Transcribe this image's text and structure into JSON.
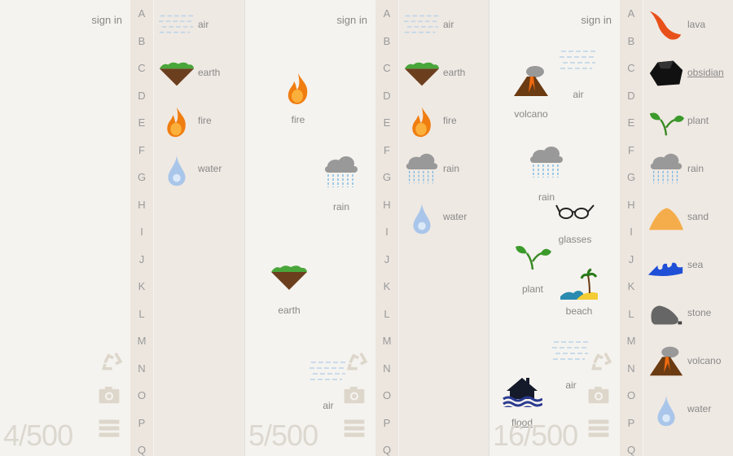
{
  "panels": [
    {
      "sign_in": "sign in",
      "counter": "4/500",
      "workspace": [],
      "list": [
        {
          "label": "air",
          "icon": "air-icon"
        },
        {
          "label": "earth",
          "icon": "earth-icon"
        },
        {
          "label": "fire",
          "icon": "fire-icon"
        },
        {
          "label": "water",
          "icon": "water-icon"
        }
      ]
    },
    {
      "sign_in": "sign in",
      "counter": "5/500",
      "workspace": [
        {
          "label": "fire",
          "icon": "fire-icon"
        },
        {
          "label": "rain",
          "icon": "rain-icon"
        },
        {
          "label": "earth",
          "icon": "earth-icon"
        },
        {
          "label": "air",
          "icon": "air-icon"
        }
      ],
      "list": [
        {
          "label": "air",
          "icon": "air-icon"
        },
        {
          "label": "earth",
          "icon": "earth-icon"
        },
        {
          "label": "fire",
          "icon": "fire-icon"
        },
        {
          "label": "rain",
          "icon": "rain-icon"
        },
        {
          "label": "water",
          "icon": "water-icon"
        }
      ]
    },
    {
      "sign_in": "sign in",
      "counter": "16/500",
      "workspace": [
        {
          "label": "volcano",
          "icon": "volcano-icon"
        },
        {
          "label": "air",
          "icon": "air-icon"
        },
        {
          "label": "rain",
          "icon": "rain-icon"
        },
        {
          "label": "glasses",
          "icon": "glasses-icon"
        },
        {
          "label": "plant",
          "icon": "plant-icon"
        },
        {
          "label": "beach",
          "icon": "beach-icon"
        },
        {
          "label": "air",
          "icon": "air-icon"
        },
        {
          "label": "flood",
          "icon": "flood-icon",
          "underlined": true
        }
      ],
      "list": [
        {
          "label": "lava",
          "icon": "lava-icon"
        },
        {
          "label": "obsidian",
          "icon": "obsidian-icon",
          "underlined": true
        },
        {
          "label": "plant",
          "icon": "plant-icon"
        },
        {
          "label": "rain",
          "icon": "rain-icon"
        },
        {
          "label": "sand",
          "icon": "sand-icon"
        },
        {
          "label": "sea",
          "icon": "sea-icon"
        },
        {
          "label": "stone",
          "icon": "stone-icon"
        },
        {
          "label": "volcano",
          "icon": "volcano-icon"
        },
        {
          "label": "water",
          "icon": "water-icon"
        }
      ]
    }
  ],
  "letters": [
    "A",
    "B",
    "C",
    "D",
    "E",
    "F",
    "G",
    "H",
    "I",
    "J",
    "K",
    "L",
    "M",
    "N",
    "O",
    "P",
    "Q"
  ],
  "tools": [
    {
      "icon": "recycle-icon"
    },
    {
      "icon": "camera-icon"
    },
    {
      "icon": "menu-icon"
    }
  ]
}
